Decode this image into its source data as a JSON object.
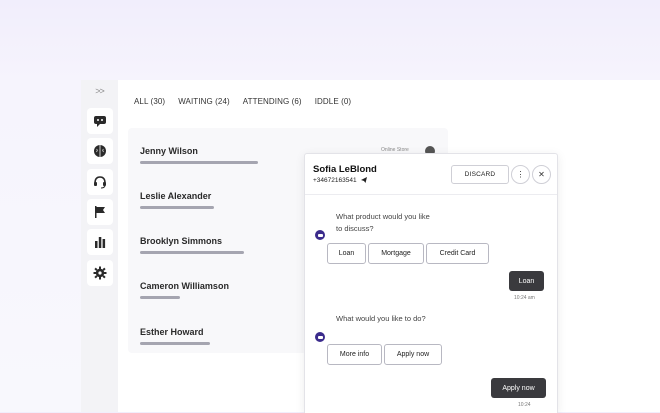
{
  "rail": {
    "expand_label": ">>",
    "items": [
      "chat-bubble-icon",
      "brain-icon",
      "headset-icon",
      "flag-icon",
      "bar-chart-icon",
      "gear-icon"
    ]
  },
  "filters": [
    {
      "label": "ALL (30)"
    },
    {
      "label": "WAITING (24)"
    },
    {
      "label": "ATTENDING (6)"
    },
    {
      "label": "IDDLE (0)"
    }
  ],
  "conversations": [
    {
      "name": "Jenny Wilson"
    },
    {
      "name": "Leslie Alexander"
    },
    {
      "name": "Brooklyn Simmons"
    },
    {
      "name": "Cameron Williamson"
    },
    {
      "name": "Esther Howard"
    }
  ],
  "list_status_hint": "Online Store",
  "chat": {
    "contact_name": "Sofia LeBlond",
    "phone": "+34672163541",
    "discard_label": "DISCARD",
    "more_label": "⋮",
    "close_label": "✕",
    "messages": [
      {
        "text": "What product would you like to discuss?",
        "options": [
          "Loan",
          "Mortgage",
          "Credit Card"
        ]
      },
      {
        "reply": "Loan",
        "time": "10:24 am"
      },
      {
        "text": "What would you like to do?",
        "options": [
          "More info",
          "Apply now"
        ]
      },
      {
        "reply": "Apply now",
        "time": "10:24"
      }
    ]
  },
  "colors": {
    "accent": "#3b2b8c",
    "user_bubble": "#3a3a3e",
    "background": "#f1eefc"
  }
}
